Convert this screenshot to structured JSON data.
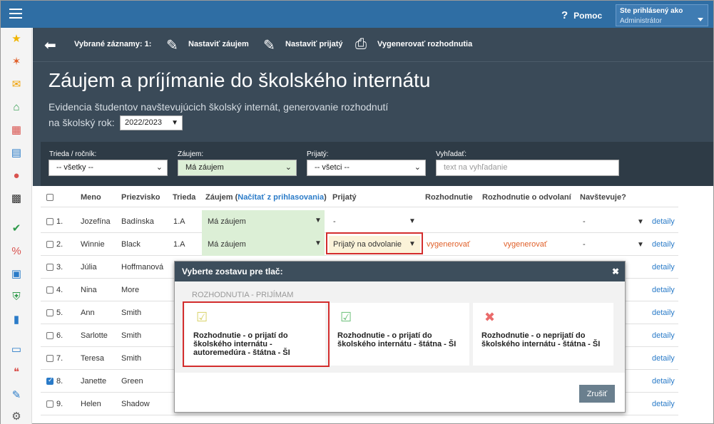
{
  "topbar": {
    "help": "Pomoc",
    "user_line1": "Ste prihlásený ako",
    "user_line2": "Administrátor"
  },
  "toolbar": {
    "selected": "Vybrané záznamy: 1:",
    "set_interest": "Nastaviť záujem",
    "set_accepted": "Nastaviť prijatý",
    "generate": "Vygenerovať rozhodnutia"
  },
  "page": {
    "title": "Záujem a príjímanie do školského internátu",
    "subtitle": "Evidencia študentov navštevujúcich školský internát, generovanie rozhodnutí",
    "year_label": "na školský rok:",
    "year": "2022/2023"
  },
  "filters": {
    "class_label": "Trieda / ročník:",
    "class_value": "-- všetky --",
    "interest_label": "Záujem:",
    "interest_value": "Má záujem",
    "accepted_label": "Prijatý:",
    "accepted_value": "-- všetci --",
    "search_label": "Vyhľadať:",
    "search_placeholder": "text na vyhľadanie"
  },
  "table": {
    "headers": {
      "meno": "Meno",
      "priezvisko": "Priezvisko",
      "trieda": "Trieda",
      "zaujem": "Záujem",
      "zaujem_link": "Načítať z prihlasovania",
      "prijaty": "Prijatý",
      "rozhodnutie": "Rozhodnutie",
      "odvolanie": "Rozhodnutie o odvolaní",
      "navstevuje": "Navštevuje?"
    },
    "rows": [
      {
        "n": "1.",
        "meno": "Jozefína",
        "priezvisko": "Badínska",
        "trieda": "1.A",
        "zaujem": "Má záujem",
        "prijaty": "-",
        "rozh": "",
        "odv": "",
        "navst": "-",
        "detail": "detaily"
      },
      {
        "n": "2.",
        "meno": "Winnie",
        "priezvisko": "Black",
        "trieda": "1.A",
        "zaujem": "Má záujem",
        "prijaty": "Prijatý na odvolanie",
        "rozh": "vygenerovať",
        "odv": "vygenerovať",
        "navst": "-",
        "detail": "detaily"
      },
      {
        "n": "3.",
        "meno": "Júlia",
        "priezvisko": "Hoffmanová",
        "detail": "detaily"
      },
      {
        "n": "4.",
        "meno": "Nina",
        "priezvisko": "More",
        "detail": "detaily"
      },
      {
        "n": "5.",
        "meno": "Ann",
        "priezvisko": "Smith",
        "detail": "detaily"
      },
      {
        "n": "6.",
        "meno": "Sarlotte",
        "priezvisko": "Smith",
        "detail": "detaily"
      },
      {
        "n": "7.",
        "meno": "Teresa",
        "priezvisko": "Smith",
        "detail": "detaily"
      },
      {
        "n": "8.",
        "meno": "Janette",
        "priezvisko": "Green",
        "detail": "detaily"
      },
      {
        "n": "9.",
        "meno": "Helen",
        "priezvisko": "Shadow",
        "detail": "detaily"
      }
    ]
  },
  "modal": {
    "title": "Vyberte zostavu pre tlač:",
    "section": "ROZHODNUTIA - PRIJÍMAM",
    "cards": [
      {
        "text": "Rozhodnutie - o prijatí do školského internátu - autoremedúra - štátna - ŠI"
      },
      {
        "text": "Rozhodnutie - o prijatí do školského internátu - štátna - ŠI"
      },
      {
        "text": "Rozhodnutie - o neprijatí do školského internátu - štátna - ŠI"
      }
    ],
    "cancel": "Zrušiť"
  },
  "colors": {
    "topbar": "#2f6ea4",
    "header_dark": "#3a4a58",
    "interest_bg": "#dcefd6",
    "link": "#2a7bc8",
    "orange": "#e0602a",
    "highlight": "#d32d2d"
  }
}
